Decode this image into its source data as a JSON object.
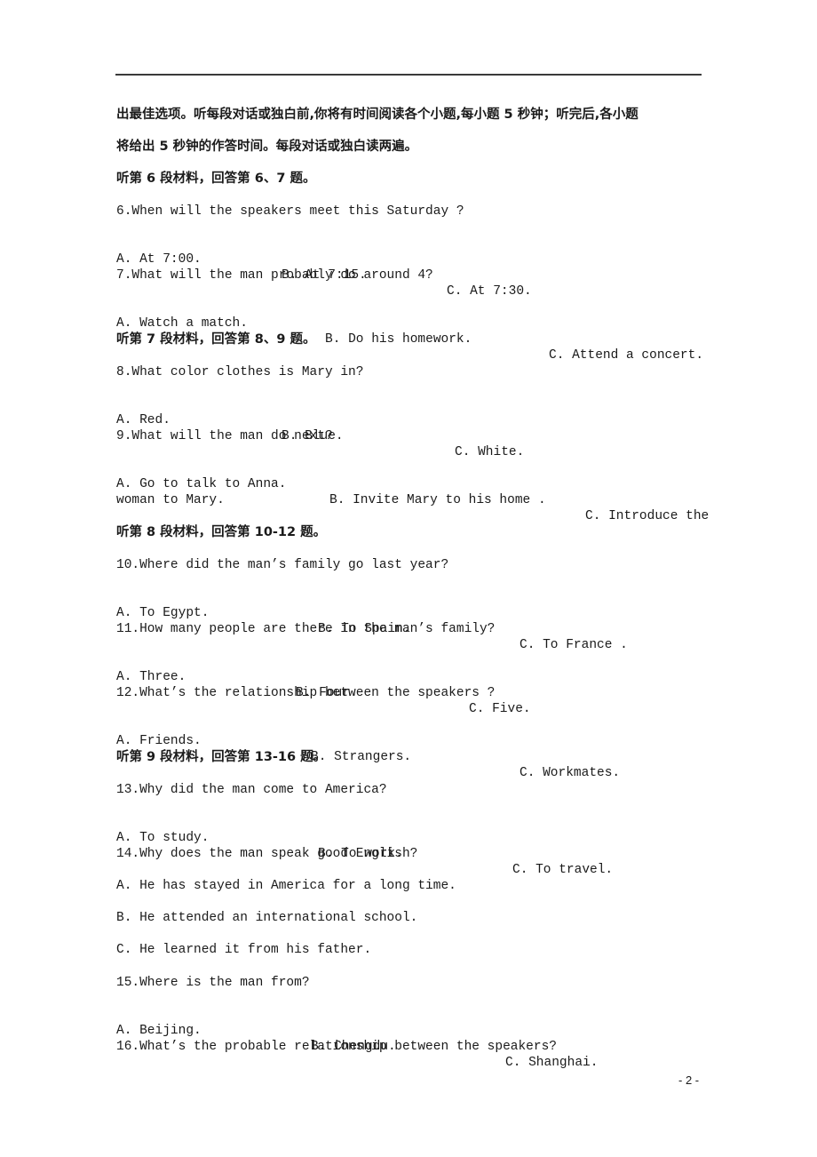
{
  "instructions": {
    "line1": "出最佳选项。听每段对话或独白前,你将有时间阅读各个小题,每小题 5 秒钟；听完后,各小题",
    "line2": "将给出 5 秒钟的作答时间。每段对话或独白读两遍。"
  },
  "sections": [
    {
      "heading": "听第 6 段材料，回答第 6、7 题。",
      "questions": [
        {
          "stem": "6.When will the speakers meet this Saturday ?",
          "options": [
            "A. At 7:00.",
            "B. At 7:15.",
            "C. At 7:30."
          ]
        },
        {
          "stem": "7.What will the man probably do around 4?",
          "options": [
            "A. Watch a match.",
            "B. Do his homework.",
            "C. Attend a concert."
          ]
        }
      ]
    },
    {
      "heading": "听第 7 段材料，回答第 8、9 题。",
      "questions": [
        {
          "stem": "8.What color clothes is Mary in?",
          "options": [
            "A. Red.",
            "B. Blue.",
            "C. White."
          ]
        },
        {
          "stem": "9.What will the man do next?",
          "options": [
            "A. Go to talk to Anna.",
            "B. Invite Mary to his home .",
            "C. Introduce the"
          ],
          "continuation": "woman to Mary."
        }
      ]
    },
    {
      "heading": "听第 8 段材料，回答第 10-12 题。",
      "questions": [
        {
          "stem": "10.Where did the man’s family go last year?",
          "options": [
            "A. To Egypt.",
            "B. To Spain.",
            "C. To France ."
          ]
        },
        {
          "stem": "11.How many people are there in the man’s family?",
          "options": [
            "A. Three.",
            "B. Four.",
            "C. Five."
          ]
        },
        {
          "stem": "12.What’s the relationship between the speakers ?",
          "options": [
            "A. Friends.",
            "B. Strangers.",
            "C. Workmates."
          ]
        }
      ]
    },
    {
      "heading": "听第 9 段材料，回答第 13-16 题。",
      "questions": [
        {
          "stem": "13.Why did the man come to America?",
          "options": [
            "A. To study.",
            "B. To work.",
            "C. To travel."
          ]
        },
        {
          "stem": "14.Why does the man speak good English?",
          "options": [
            "A. He has stayed in America for a long time.",
            "B. He attended an international school.",
            "C. He learned it from his father."
          ]
        },
        {
          "stem": "15.Where is the man from?",
          "options": [
            "A. Beijing.",
            "B. Chengdu.",
            "C. Shanghai."
          ]
        },
        {
          "stem": "16.What’s the probable relationship between the speakers?"
        }
      ]
    }
  ],
  "footer": {
    "page_number": "- 2 -"
  }
}
